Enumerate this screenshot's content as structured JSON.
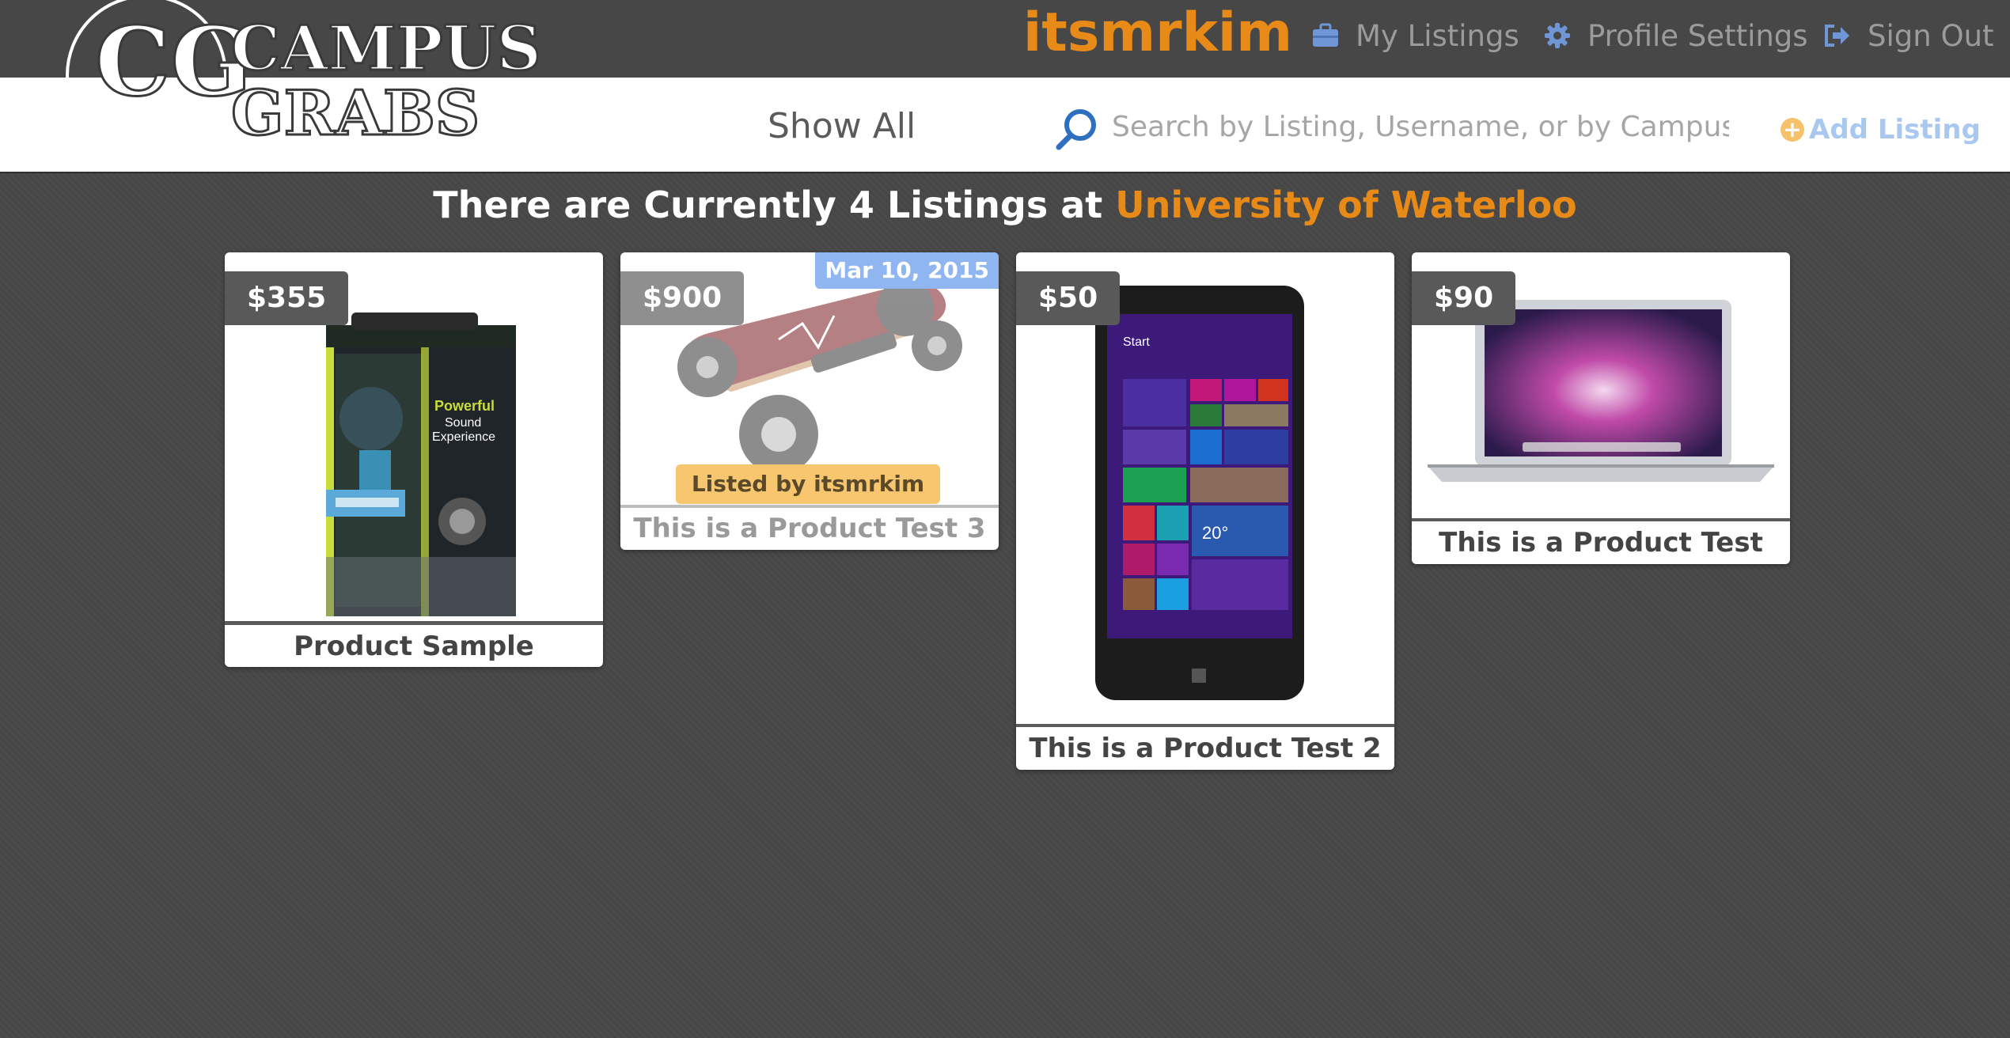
{
  "brand": {
    "line1": "CAMPUS",
    "line2": "GRABS",
    "monogram": "CG"
  },
  "header": {
    "username": "itsmrkim",
    "nav": [
      {
        "label": "My Listings",
        "icon": "briefcase-icon"
      },
      {
        "label": "Profile Settings",
        "icon": "gear-icon"
      },
      {
        "label": "Sign Out",
        "icon": "sign-out-icon"
      }
    ]
  },
  "toolbar": {
    "show_all": "Show All",
    "search_placeholder": "Search by Listing, Username, or by Campus!",
    "search_value": "",
    "add_listing": "Add Listing"
  },
  "main": {
    "heading_prefix": "There are Currently 4 Listings at ",
    "campus": "University of Waterloo",
    "listings": [
      {
        "price": "$355",
        "title": "Product Sample",
        "image": "headphones-box-image"
      },
      {
        "price": "$900",
        "title": "This is a Product Test 3",
        "date": "Mar 10, 2015",
        "listed_by": "Listed by itsmrkim",
        "image": "electric-skateboard-image"
      },
      {
        "price": "$50",
        "title": "This is a Product Test 2",
        "image": "tablet-image"
      },
      {
        "price": "$90",
        "title": "This is a Product Test",
        "image": "laptop-image"
      }
    ]
  },
  "colors": {
    "accent": "#e88a17",
    "link": "#a9c8f0",
    "background": "#474747",
    "badge_date": "#8fb6f0",
    "badge_listed": "#f8c66f"
  }
}
